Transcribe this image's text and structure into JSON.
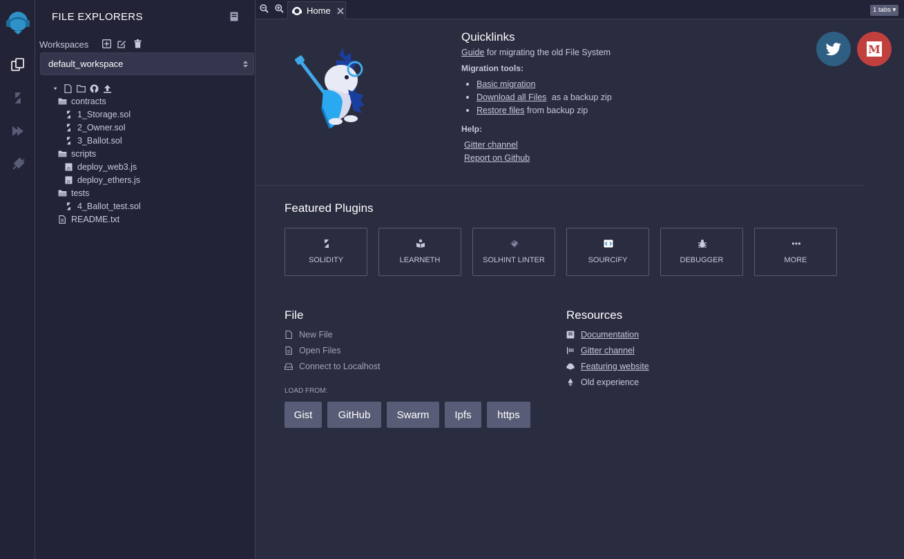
{
  "colors": {
    "bg": "#2a2c3f",
    "panel": "#222336",
    "accent": "#2e92c8",
    "twitter": "#2e5e82",
    "medium": "#c1403e",
    "button": "#595c76"
  },
  "side_panel": {
    "title": "FILE EXPLORERS",
    "workspaces_label": "Workspaces",
    "workspace_selected": "default_workspace",
    "tree": [
      {
        "name": "contracts",
        "type": "folder"
      },
      {
        "name": "1_Storage.sol",
        "type": "sol"
      },
      {
        "name": "2_Owner.sol",
        "type": "sol"
      },
      {
        "name": "3_Ballot.sol",
        "type": "sol"
      },
      {
        "name": "scripts",
        "type": "folder"
      },
      {
        "name": "deploy_web3.js",
        "type": "js"
      },
      {
        "name": "deploy_ethers.js",
        "type": "js"
      },
      {
        "name": "tests",
        "type": "folder"
      },
      {
        "name": "4_Ballot_test.sol",
        "type": "sol"
      },
      {
        "name": "README.txt",
        "type": "file"
      }
    ]
  },
  "tabbar": {
    "home_tab": "Home",
    "tabs_count": "1 tabs"
  },
  "quicklinks": {
    "title": "Quicklinks",
    "guide_link": "Guide",
    "guide_text": "for migrating the old File System",
    "migration_label": "Migration tools:",
    "basic_migration": "Basic migration",
    "download_all": "Download all Files",
    "download_suffix": "as a backup zip",
    "restore": "Restore files",
    "restore_suffix": "from backup zip",
    "help_label": "Help:",
    "gitter": "Gitter channel",
    "report": "Report on Github"
  },
  "featured": {
    "title": "Featured Plugins",
    "plugins": [
      "SOLIDITY",
      "LEARNETH",
      "SOLHINT LINTER",
      "SOURCIFY",
      "DEBUGGER",
      "MORE"
    ]
  },
  "file_section": {
    "title": "File",
    "new_file": "New File",
    "open_files": "Open Files",
    "connect": "Connect to Localhost",
    "load_from": "LOAD FROM:",
    "load_buttons": [
      "Gist",
      "GitHub",
      "Swarm",
      "Ipfs",
      "https"
    ]
  },
  "resources": {
    "title": "Resources",
    "documentation": "Documentation",
    "gitter": "Gitter channel",
    "featuring": "Featuring website",
    "old_experience": "Old experience"
  }
}
